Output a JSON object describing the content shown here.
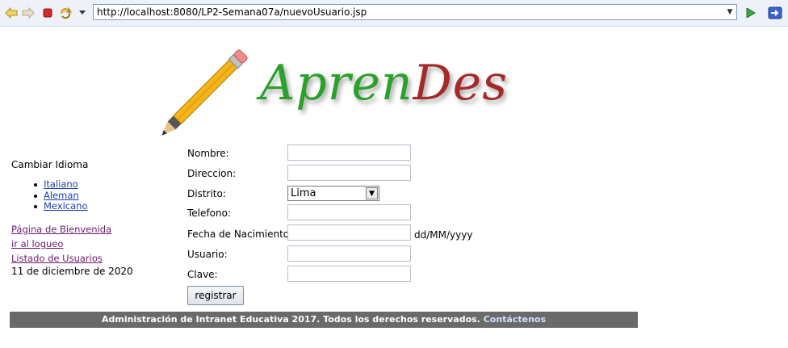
{
  "browser": {
    "url": "http://localhost:8080/LP2-Semana07a/nuevoUsuario.jsp"
  },
  "logo": {
    "part1": "Apren",
    "part2": "Des",
    "colors": {
      "green": "#2aa12a",
      "red": "#a52a2a"
    }
  },
  "sidebar": {
    "title": "Cambiar Idioma",
    "languages": [
      "Italiano",
      "Aleman",
      "Mexicano"
    ],
    "links": [
      "Página de Bienvenida",
      "ir al logueo",
      "Listado de Usuarios"
    ],
    "date": "11 de diciembre de 2020"
  },
  "form": {
    "nombre_label": "Nombre:",
    "direccion_label": "Direccion:",
    "distrito_label": "Distrito:",
    "distrito_value": "Lima",
    "telefono_label": "Telefono:",
    "fecha_label": "Fecha de Nacimiento:",
    "fecha_format": "dd/MM/yyyy",
    "usuario_label": "Usuario:",
    "clave_label": "Clave:",
    "submit_label": "registrar"
  },
  "footer": {
    "text": "Administración de Intranet Educativa 2017. Todos los derechos reservados.",
    "link": "Contáctenos"
  }
}
